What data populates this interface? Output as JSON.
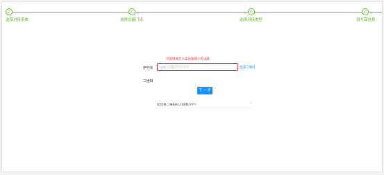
{
  "steps": [
    {
      "label": "选择对接系统",
      "done": true
    },
    {
      "label": "选择对接门店",
      "done": true
    },
    {
      "label": "选择对接类型",
      "done": true
    },
    {
      "label": "填写算信息",
      "done": true
    }
  ],
  "step_check_glyph": "✓",
  "form": {
    "error_message": "只支持填写人类设备或人脸设备",
    "serial_label": "序列号",
    "serial_placeholder": "请输入设备序列号/序号",
    "serial_value": "",
    "gen_qr_link": "生成二维码",
    "qr_label": "二维码",
    "next_button": "下 一 步",
    "help_text": "如何将二维码扫入鲜哦APP?",
    "help_chevron": "›"
  },
  "colors": {
    "step": "#52c41a",
    "error": "#e0393e",
    "primary": "#1890ff"
  }
}
